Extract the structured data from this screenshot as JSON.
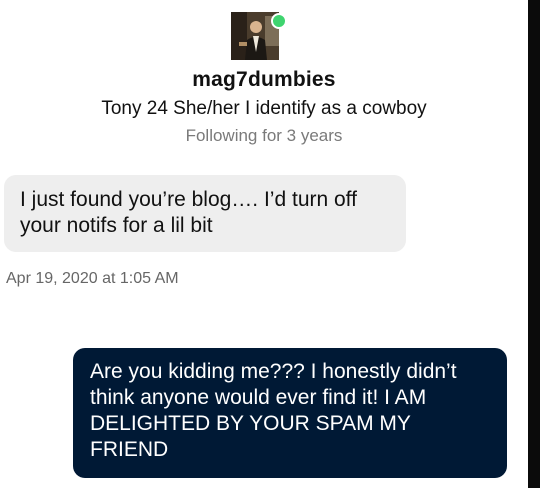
{
  "profile": {
    "username": "mag7dumbies",
    "bio": "Tony 24 She/her I identify as a cowboy",
    "following": "Following for 3 years",
    "status_color": "#3fd46f"
  },
  "messages": [
    {
      "direction": "received",
      "text": "I just found you’re blog…. I’d turn off your notifs for a lil bit"
    },
    {
      "direction": "sent",
      "text": "Are you kidding me??? I honestly didn’t think anyone would ever find it! I AM DELIGHTED BY YOUR SPAM MY FRIEND"
    }
  ],
  "timestamp": "Apr 19, 2020 at 1:05 AM",
  "colors": {
    "received_bubble": "#eeeeee",
    "sent_bubble": "#001935"
  }
}
